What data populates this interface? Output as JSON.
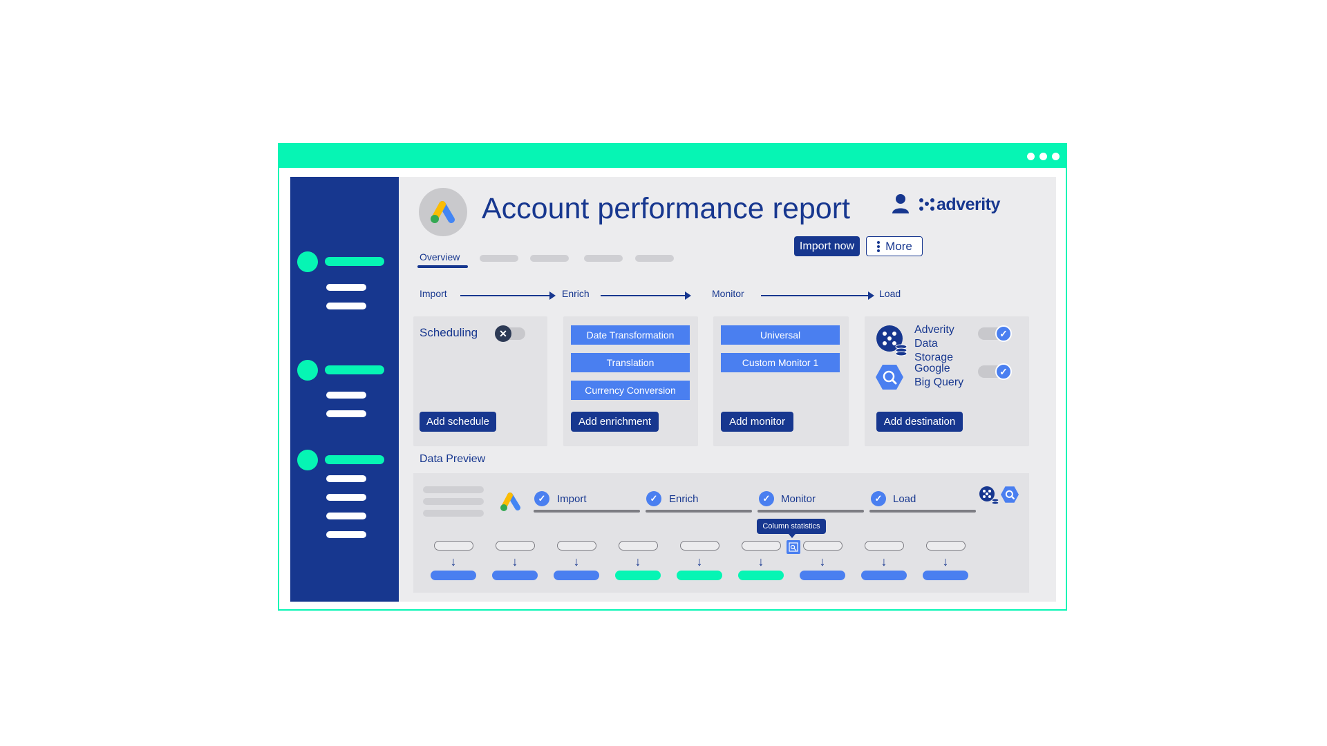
{
  "header": {
    "title": "Account performance report",
    "brand": "adverity",
    "import_now_label": "Import now",
    "more_label": "More"
  },
  "tabs": {
    "active_label": "Overview"
  },
  "pipeline": {
    "steps": [
      "Import",
      "Enrich",
      "Monitor",
      "Load"
    ]
  },
  "import_card": {
    "scheduling_label": "Scheduling",
    "add_label": "Add schedule",
    "toggle_state": "off"
  },
  "enrich_card": {
    "chips": [
      "Date Transformation",
      "Translation",
      "Currency Conversion"
    ],
    "add_label": "Add enrichment"
  },
  "monitor_card": {
    "chips": [
      "Universal",
      "Custom Monitor 1"
    ],
    "add_label": "Add monitor"
  },
  "load_card": {
    "destinations": [
      {
        "name_lines": [
          "Adverity",
          "Data",
          "Storage"
        ],
        "enabled": true
      },
      {
        "name_lines": [
          "Google",
          "Big Query"
        ],
        "enabled": true
      }
    ],
    "add_label": "Add destination"
  },
  "preview": {
    "label": "Data Preview",
    "stages": [
      "Import",
      "Enrich",
      "Monitor",
      "Load"
    ],
    "tooltip": "Column statistics"
  },
  "colors": {
    "accent_green": "#06f5b4",
    "navy": "#17378f",
    "blue": "#4a7ff0",
    "panel_gray": "#ececee"
  }
}
